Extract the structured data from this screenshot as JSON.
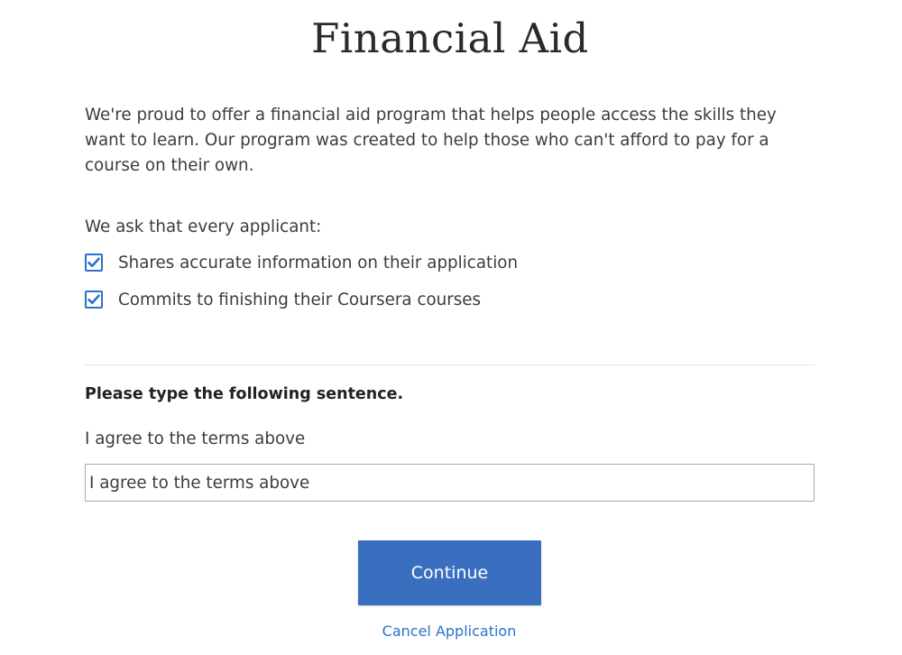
{
  "page": {
    "title": "Financial Aid",
    "intro": "We're proud to offer a financial aid program that helps people access the skills they want to learn. Our program was created to help those who can't afford to pay for a course on their own."
  },
  "requirements": {
    "heading": "We ask that every applicant:",
    "items": [
      {
        "label": "Shares accurate information on their application",
        "checked": true
      },
      {
        "label": "Commits to finishing their Coursera courses",
        "checked": true
      }
    ]
  },
  "agreement": {
    "prompt": "Please type the following sentence.",
    "sentence": "I agree to the terms above",
    "input_value": "I agree to the terms above"
  },
  "actions": {
    "continue_label": "Continue",
    "cancel_label": "Cancel Application"
  },
  "colors": {
    "accent": "#2a73cc",
    "button": "#3a6fc0"
  },
  "icons": {
    "checkbox": "checkmark-icon"
  }
}
